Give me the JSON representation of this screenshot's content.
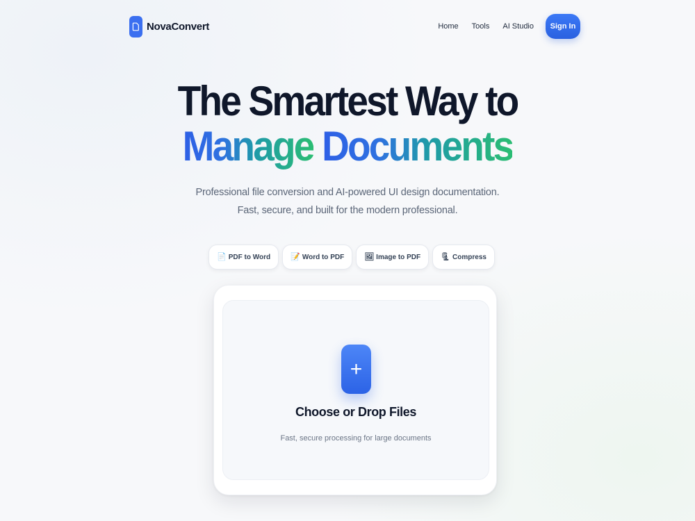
{
  "nav": {
    "brand": "NovaConvert",
    "links": [
      "Home",
      "Tools",
      "AI Studio"
    ],
    "signin_label": "Sign In"
  },
  "hero": {
    "line1": "The Smartest Way to",
    "line2_word1": "Manage",
    "line2_word2": "Documents",
    "subtitle_line1": "Professional file conversion and AI-powered UI design documentation.",
    "subtitle_line2": "Fast, secure, and built for the modern professional."
  },
  "chips": [
    {
      "icon": "📄",
      "label": "PDF to Word",
      "icon_name": "document-icon"
    },
    {
      "icon": "📝",
      "label": "Word to PDF",
      "icon_name": "memo-icon"
    },
    {
      "icon": "🖼",
      "label": "Image to PDF",
      "icon_name": "picture-icon"
    },
    {
      "icon": "🗜",
      "label": "Compress",
      "icon_name": "clamp-icon"
    }
  ],
  "upload": {
    "plus": "+",
    "title": "Choose or Drop Files",
    "subtitle": "Fast, secure processing for large documents"
  },
  "colors": {
    "accent": "#2c63e6",
    "gradient_start": "#2e5fe6",
    "gradient_end": "#2bbd73",
    "text_dark": "#0f172a"
  }
}
